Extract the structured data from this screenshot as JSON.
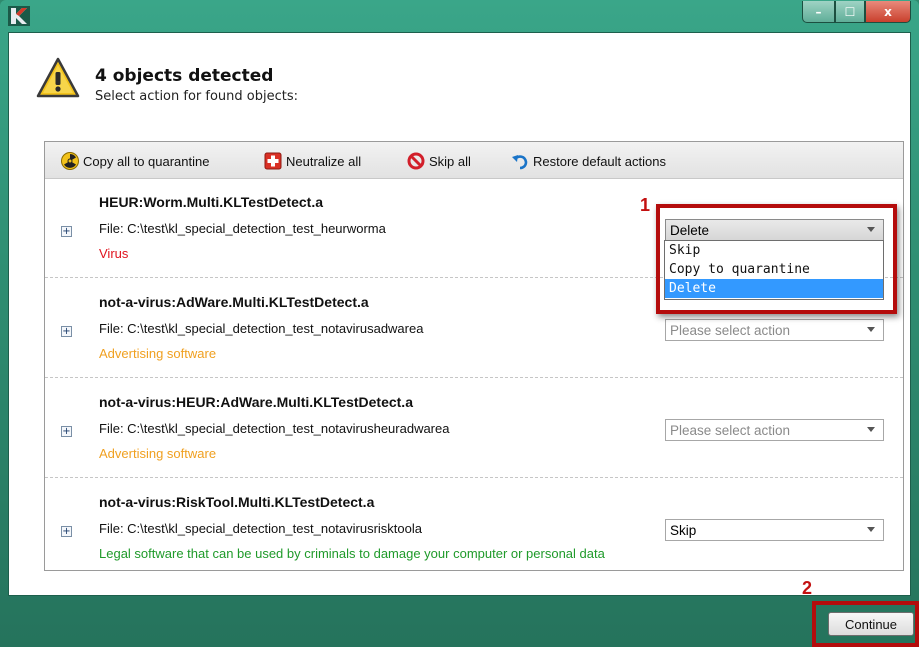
{
  "window": {
    "buttons": {
      "minimize": "–",
      "maximize": "☐",
      "close": "x"
    }
  },
  "header": {
    "title": "4 objects detected",
    "subtitle": "Select action for found objects:"
  },
  "toolbar": {
    "copy_all": "Copy all to quarantine",
    "neutralize_all": "Neutralize all",
    "skip_all": "Skip all",
    "restore_default": "Restore default actions"
  },
  "objects": [
    {
      "name": "HEUR:Worm.Multi.KLTestDetect.a",
      "file": "File: C:\\test\\kl_special_detection_test_heurworma",
      "category": "Virus",
      "category_color": "#e0141e",
      "action": "Delete",
      "placeholder": false
    },
    {
      "name": "not-a-virus:AdWare.Multi.KLTestDetect.a",
      "file": "File: C:\\test\\kl_special_detection_test_notavirusadwarea",
      "category": "Advertising software",
      "category_color": "#f0a020",
      "action": "Please select action",
      "placeholder": true
    },
    {
      "name": "not-a-virus:HEUR:AdWare.Multi.KLTestDetect.a",
      "file": "File: C:\\test\\kl_special_detection_test_notavirusheuradwarea",
      "category": "Advertising software",
      "category_color": "#f0a020",
      "action": "Please select action",
      "placeholder": true
    },
    {
      "name": "not-a-virus:RiskTool.Multi.KLTestDetect.a",
      "file": "File: C:\\test\\kl_special_detection_test_notavirusrisktoola",
      "category": "Legal software that can be used by criminals to damage your computer or personal data",
      "category_color": "#1f9a2a",
      "action": "Skip",
      "placeholder": false
    }
  ],
  "dropdown": {
    "options": [
      "Skip",
      "Copy to quarantine",
      "Delete"
    ],
    "selected": "Delete"
  },
  "annotations": {
    "mark1": "1",
    "mark2": "2"
  },
  "footer": {
    "continue_label": "Continue"
  },
  "colors": {
    "accent": "#3399ff",
    "highlight": "#b40c0c"
  }
}
